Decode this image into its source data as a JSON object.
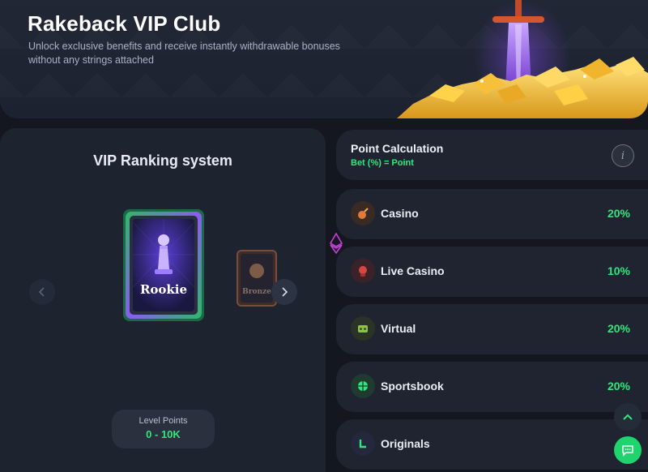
{
  "hero": {
    "title": "Rakeback VIP Club",
    "subtitle": "Unlock exclusive benefits and receive instantly withdrawable bonuses without any strings attached"
  },
  "ranking": {
    "title": "VIP Ranking system",
    "current_card": "Rookie",
    "next_card": "Bronze",
    "level_label": "Level Points",
    "level_value": "0 - 10K"
  },
  "calculation": {
    "title": "Point Calculation",
    "formula": "Bet (%) = Point",
    "info_glyph": "i"
  },
  "categories": [
    {
      "label": "Casino",
      "percent": "20%",
      "icon": "casino-icon",
      "color": "#e07a3a"
    },
    {
      "label": "Live Casino",
      "percent": "10%",
      "icon": "live-casino-icon",
      "color": "#d6483f"
    },
    {
      "label": "Virtual",
      "percent": "20%",
      "icon": "virtual-icon",
      "color": "#8bc34a"
    },
    {
      "label": "Sportsbook",
      "percent": "20%",
      "icon": "sportsbook-icon",
      "color": "#2ee87d"
    },
    {
      "label": "Originals",
      "percent": "",
      "icon": "originals-icon",
      "color": "#2ee87d"
    }
  ],
  "colors": {
    "accent_green": "#2ee87d",
    "background": "#14171f",
    "panel": "#1f2430"
  }
}
